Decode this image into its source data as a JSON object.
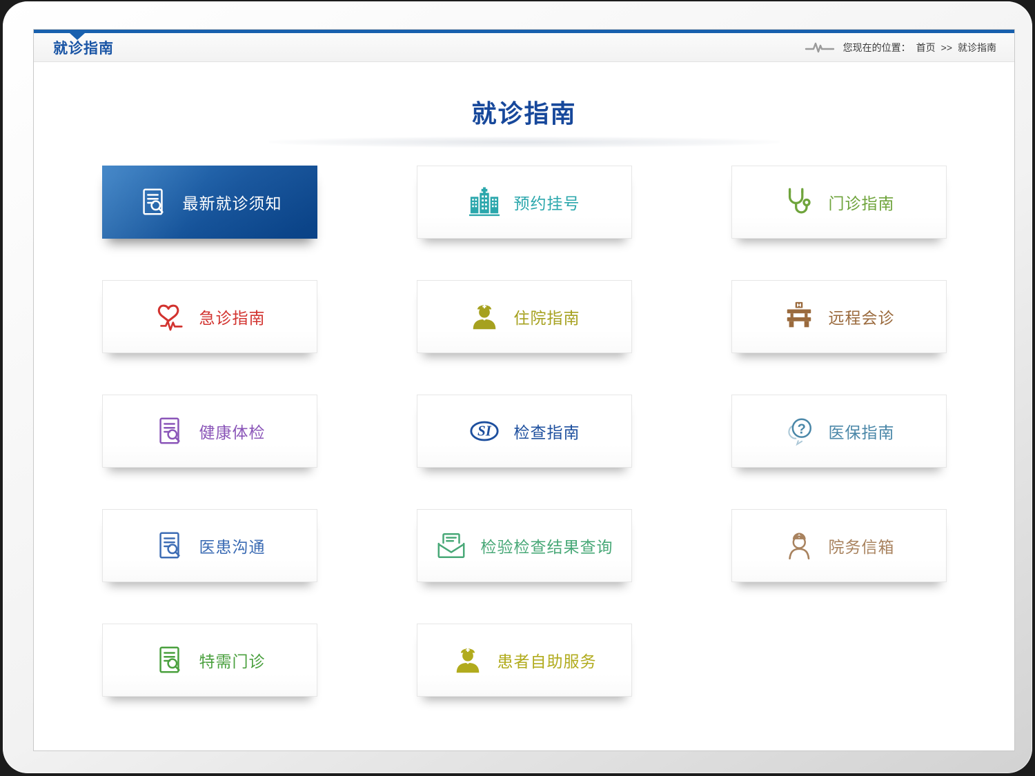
{
  "header": {
    "section_title": "就诊指南",
    "breadcrumb": {
      "prefix": "您现在的位置：",
      "home": "首页",
      "separator": ">>",
      "current": "就诊指南"
    }
  },
  "main": {
    "page_title": "就诊指南",
    "cards": [
      {
        "label": "最新就诊须知",
        "icon": "document-search-icon",
        "color": "#ffffff",
        "active": true
      },
      {
        "label": "预约挂号",
        "icon": "hospital-buildings-icon",
        "color": "#2ba7ac",
        "active": false
      },
      {
        "label": "门诊指南",
        "icon": "stethoscope-icon",
        "color": "#6fa43c",
        "active": false
      },
      {
        "label": "急诊指南",
        "icon": "heart-ecg-icon",
        "color": "#d2332f",
        "active": false
      },
      {
        "label": "住院指南",
        "icon": "nurse-icon",
        "color": "#a6a11f",
        "active": false
      },
      {
        "label": "远程会诊",
        "icon": "hospital-flag-icon",
        "color": "#9a6a3d",
        "active": false
      },
      {
        "label": "健康体检",
        "icon": "document-search-icon",
        "color": "#8a55b8",
        "active": false
      },
      {
        "label": "检查指南",
        "icon": "si-logo-icon",
        "color": "#1d4f9e",
        "active": false
      },
      {
        "label": "医保指南",
        "icon": "question-bubbles-icon",
        "color": "#4a87a8",
        "active": false
      },
      {
        "label": "医患沟通",
        "icon": "document-search-icon",
        "color": "#3c6cb4",
        "active": false
      },
      {
        "label": "检验检查结果查询",
        "icon": "envelope-letter-icon",
        "color": "#48a877",
        "active": false
      },
      {
        "label": "院务信箱",
        "icon": "doctor-icon",
        "color": "#a8825e",
        "active": false
      },
      {
        "label": "特需门诊",
        "icon": "document-search-icon",
        "color": "#4aa03e",
        "active": false
      },
      {
        "label": "患者自助服务",
        "icon": "nurse-icon",
        "color": "#b1ab1d",
        "active": false
      }
    ]
  },
  "colors": {
    "accent_blue": "#1a55a5",
    "header_bar_blue": "#1860ae",
    "active_card_gradient_start": "#2271bd",
    "active_card_gradient_end": "#0b4892"
  }
}
